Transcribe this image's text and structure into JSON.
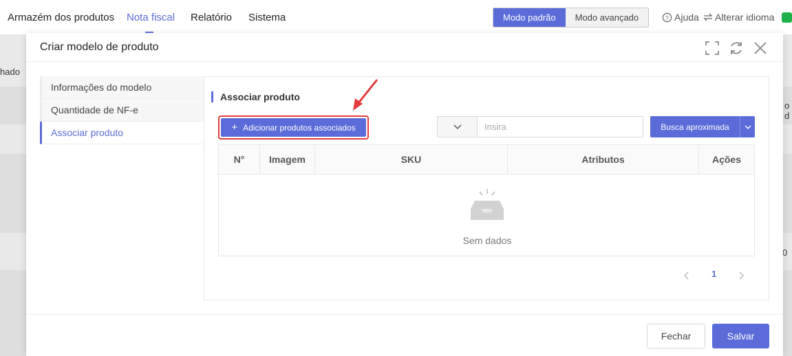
{
  "nav": {
    "items": [
      {
        "label": "Armazém dos produtos"
      },
      {
        "label": "Nota fiscal"
      },
      {
        "label": "Relatório"
      },
      {
        "label": "Sistema"
      }
    ],
    "mode_standard": "Modo padrão",
    "mode_advanced": "Modo avançado",
    "help": "Ajuda",
    "change_language": "Alterar idioma"
  },
  "background": {
    "col_fragment": "hado",
    "right_fragment_1": "o d",
    "right_fragment_2": "0"
  },
  "modal": {
    "title": "Criar modelo de produto",
    "menu": [
      {
        "label": "Informações do modelo"
      },
      {
        "label": "Quantidade de NF-e"
      },
      {
        "label": "Associar produto"
      }
    ],
    "section_title": "Associar produto",
    "add_button": "Adicionar produtos associados",
    "search_placeholder": "Insira",
    "search_button": "Busca aproximada",
    "table": {
      "headers": [
        "N°",
        "Imagem",
        "SKU",
        "Atributos",
        "Ações"
      ],
      "empty_text": "Sem dados"
    },
    "pagination": {
      "current": "1"
    },
    "close_button": "Fechar",
    "save_button": "Salvar"
  },
  "colors": {
    "accent": "#5b6bd9",
    "highlight": "#e23b3b"
  }
}
